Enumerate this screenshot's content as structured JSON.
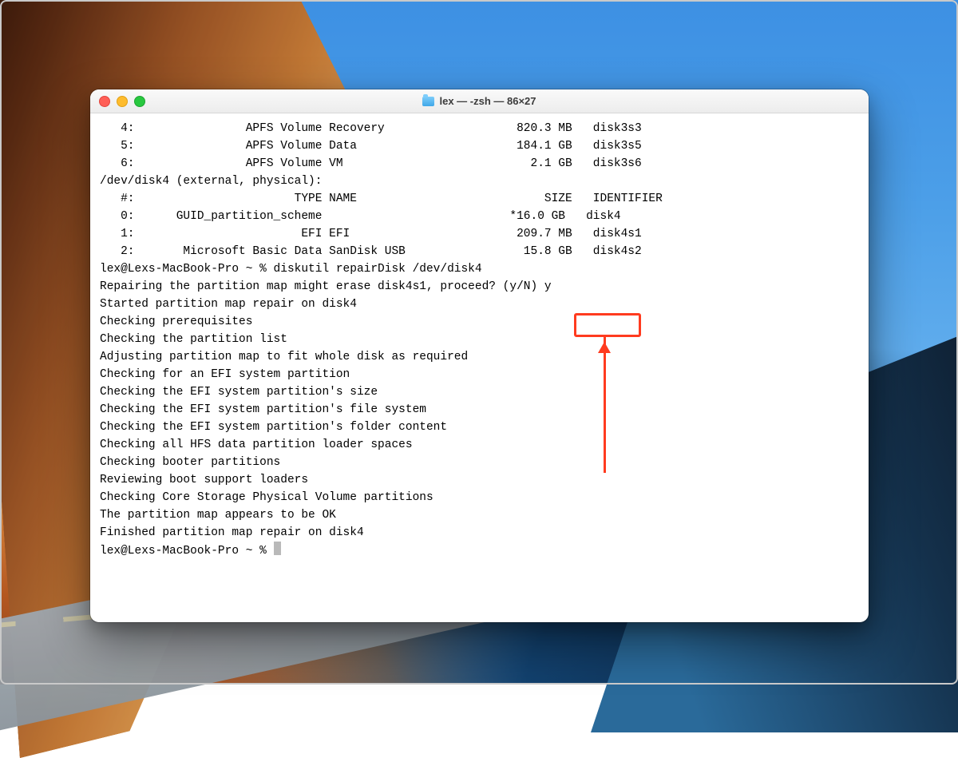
{
  "window": {
    "title": "lex — -zsh — 86×27"
  },
  "disk3_rows": [
    {
      "idx": "   4:",
      "type": "                APFS Volume ",
      "name": "Recovery",
      "size": "820.3 MB",
      "id": "disk3s3"
    },
    {
      "idx": "   5:",
      "type": "                APFS Volume ",
      "name": "Data",
      "size": "184.1 GB",
      "id": "disk3s5"
    },
    {
      "idx": "   6:",
      "type": "                APFS Volume ",
      "name": "VM",
      "size": "2.1 GB",
      "id": "disk3s6"
    }
  ],
  "disk4_header": "/dev/disk4 (external, physical):",
  "disk4_colhdr": {
    "idx": "   #:",
    "type": "                       TYPE ",
    "name": "NAME",
    "size": "SIZE",
    "id": "IDENTIFIER"
  },
  "disk4_rows": [
    {
      "idx": "   0:",
      "type": "      GUID_partition_scheme",
      "name": "",
      "size": "*16.0 GB",
      "id": "disk4"
    },
    {
      "idx": "   1:",
      "type": "                        EFI ",
      "name": "EFI",
      "size": "209.7 MB",
      "id": "disk4s1"
    },
    {
      "idx": "   2:",
      "type": "       Microsoft Basic Data ",
      "name": "SanDisk USB",
      "size": "15.8 GB",
      "id": "disk4s2"
    }
  ],
  "cmd_prompt": "lex@Lexs-MacBook-Pro ~ % ",
  "cmd": "diskutil repairDisk /dev/disk4",
  "confirm_line_pre": "Repairing the partition map might erase disk4s1, proceed? ",
  "confirm_token": "(y/N) y",
  "output_lines": [
    "Started partition map repair on disk4",
    "Checking prerequisites",
    "Checking the partition list",
    "Adjusting partition map to fit whole disk as required",
    "Checking for an EFI system partition",
    "Checking the EFI system partition's size",
    "Checking the EFI system partition's file system",
    "Checking the EFI system partition's folder content",
    "Checking all HFS data partition loader spaces",
    "Checking booter partitions",
    "Reviewing boot support loaders",
    "Checking Core Storage Physical Volume partitions",
    "The partition map appears to be OK",
    "Finished partition map repair on disk4"
  ],
  "final_prompt": "lex@Lexs-MacBook-Pro ~ % "
}
